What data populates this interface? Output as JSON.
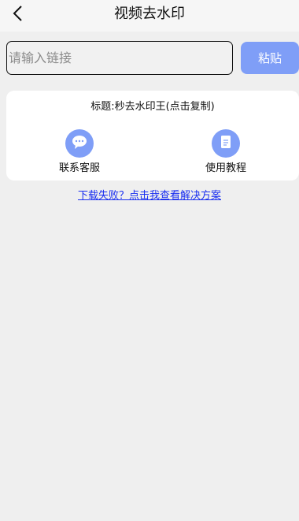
{
  "header": {
    "back_icon": "chevron-left-icon",
    "title": "视频去水印"
  },
  "input": {
    "value": "",
    "placeholder": "请输入链接"
  },
  "paste_button": {
    "label": "粘贴",
    "color": "#7f9ef7"
  },
  "card": {
    "title": "标题:秒去水印王(点击复制)",
    "actions": [
      {
        "label": "联系客服",
        "icon": "chat-bubble-icon"
      },
      {
        "label": "使用教程",
        "icon": "document-icon"
      }
    ]
  },
  "help_link": {
    "label": "下载失败？点击我查看解决方案",
    "color": "#1a2ff0"
  },
  "colors": {
    "accent": "#7f9ef7",
    "background": "#efefef"
  }
}
